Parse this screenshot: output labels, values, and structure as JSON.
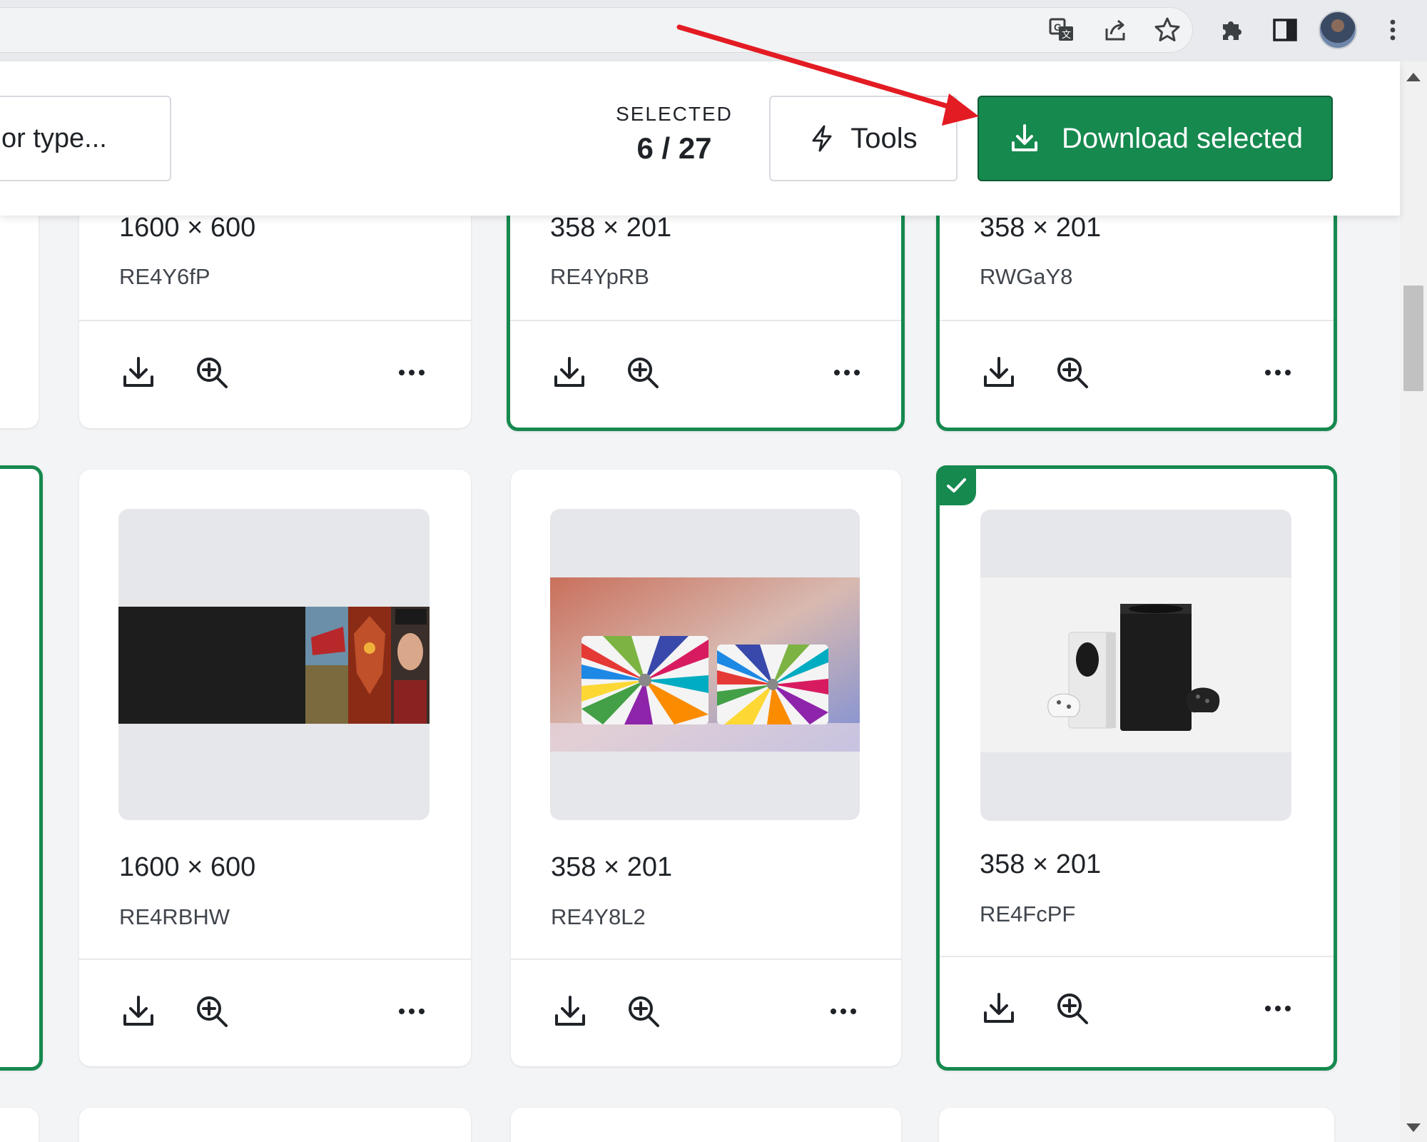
{
  "colors": {
    "accent": "#16894f",
    "selected_border": "#16894f",
    "annotation_arrow": "#e31b23"
  },
  "browser_toolbar": {
    "icons": [
      "translate-icon",
      "share-icon",
      "star-icon",
      "extensions-icon",
      "side-panel-icon",
      "profile-avatar",
      "menu-dots-icon"
    ]
  },
  "header": {
    "filter_placeholder": "or type...",
    "selected_label": "SELECTED",
    "selected_count": "6 / 27",
    "tools_label": "Tools",
    "download_label": "Download selected"
  },
  "cards": [
    {
      "dimensions": "1600 × 600",
      "name": "RE4Y6fP",
      "selected": false
    },
    {
      "dimensions": "358 × 201",
      "name": "RE4YpRB",
      "selected": true
    },
    {
      "dimensions": "358 × 201",
      "name": "RWGaY8",
      "selected": true
    },
    {
      "dimensions": "1600 × 600",
      "name": "RE4RBHW",
      "selected": false
    },
    {
      "dimensions": "358 × 201",
      "name": "RE4Y8L2",
      "selected": false
    },
    {
      "dimensions": "358 × 201",
      "name": "RE4FcPF",
      "selected": true
    }
  ]
}
